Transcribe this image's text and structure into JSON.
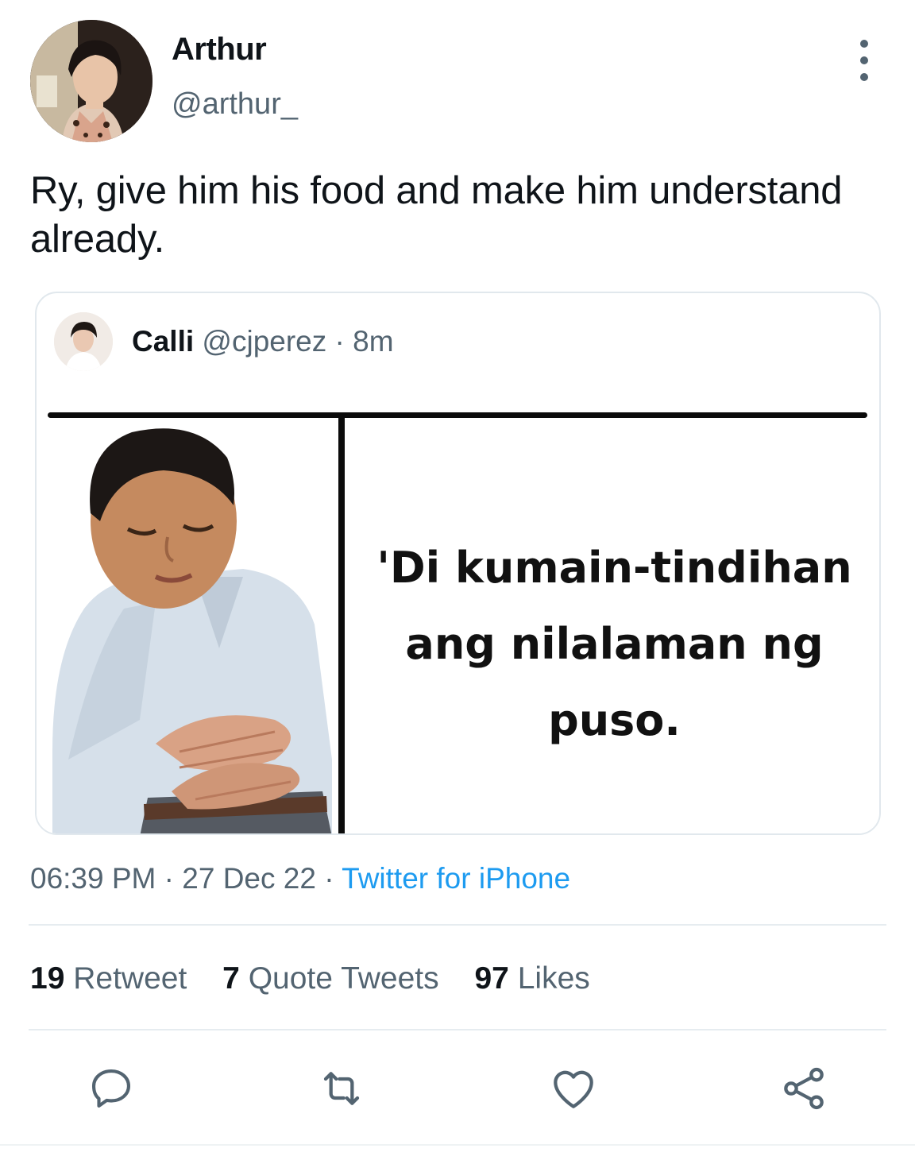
{
  "author": {
    "display_name": "Arthur",
    "handle": "@arthur_"
  },
  "tweet": {
    "text": "Ry, give him his food and make him understand already."
  },
  "quote": {
    "display_name": "Calli",
    "handle": "@cjperez",
    "separator": " · ",
    "age": "8m",
    "meme_caption": "'Di kumain-tindihan ang nilalaman ng puso."
  },
  "meta": {
    "time": "06:39 PM",
    "separator": " · ",
    "date": "27 Dec 22",
    "source": "Twitter for iPhone"
  },
  "stats": [
    {
      "count": "19",
      "label": "Retweet"
    },
    {
      "count": "7",
      "label": "Quote Tweets"
    },
    {
      "count": "97",
      "label": "Likes"
    }
  ],
  "actions": {
    "icons": [
      "reply-icon",
      "retweet-icon",
      "like-icon",
      "share-icon"
    ]
  },
  "colors": {
    "text": "#0f1419",
    "muted": "#536471",
    "link": "#1d9bf0",
    "border": "#e1e8ed"
  }
}
